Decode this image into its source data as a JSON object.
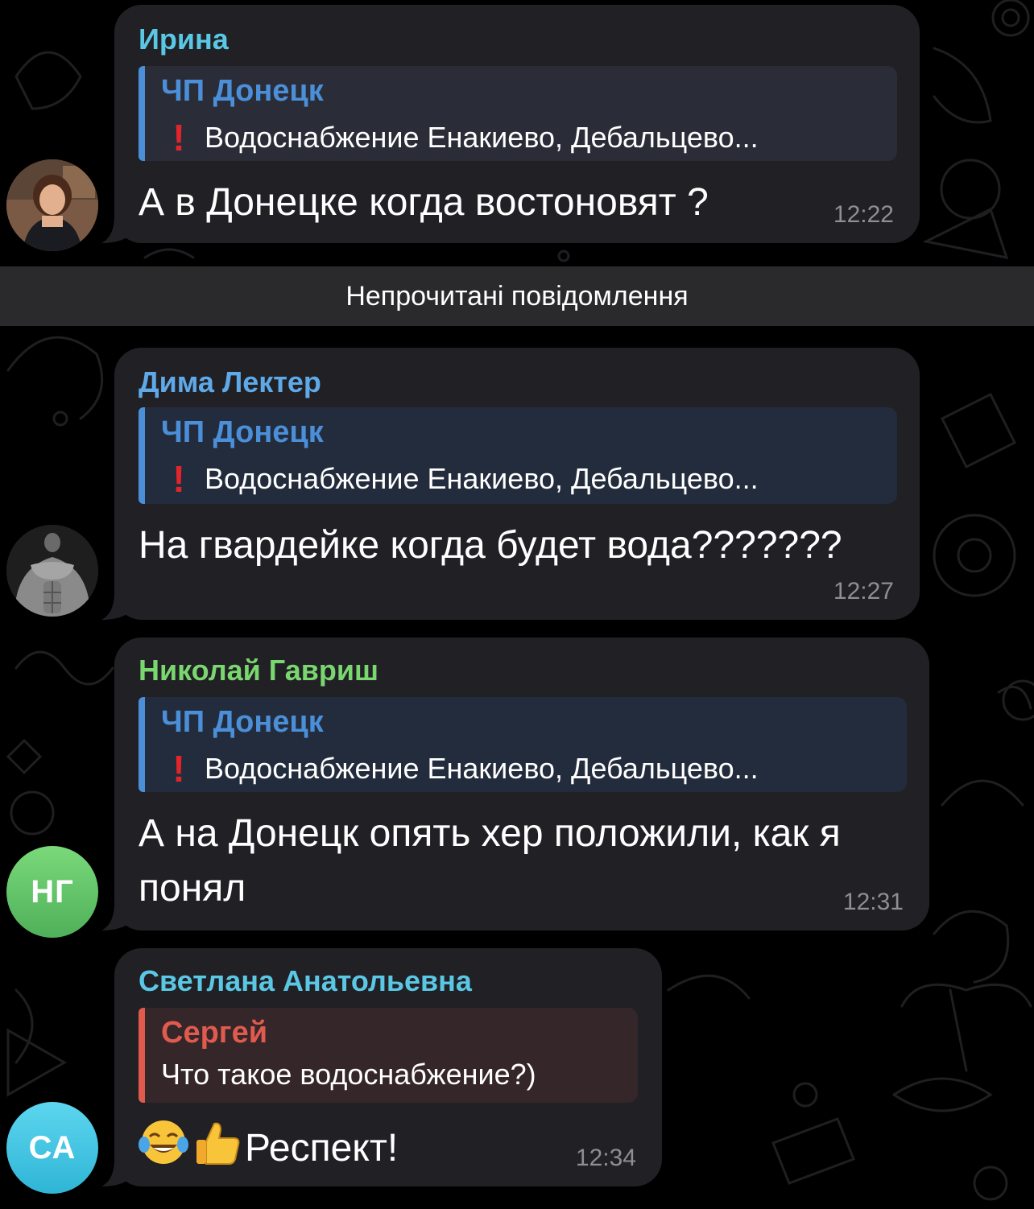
{
  "colors": {
    "bubble_bg": "#212025",
    "unread_bar_bg": "#2a2a2d",
    "sender_cyan": "#5ac8e5",
    "sender_blue": "#5fa9e8",
    "sender_green": "#7ad66f",
    "reply_blue": "#4b8fd9",
    "reply_red": "#e05a4e",
    "time_gray": "#8e8e93",
    "avatar_green": "#61c264",
    "avatar_cyan": "#3cc8e6"
  },
  "unread_divider": "Непрочитані повідомлення",
  "messages": [
    {
      "sender": "Ирина",
      "sender_color": "#5ac8e5",
      "avatar_icon": "photo-woman",
      "reply_title": "ЧП Донецк",
      "reply_text": "Водоснабжение Енакиево, Дебальцево...",
      "text": "А в Донецке когда востоновят ?",
      "time": "12:22"
    },
    {
      "sender": "Дима Лектер",
      "sender_color": "#5fa9e8",
      "avatar_icon": "photo-muscular-man",
      "reply_title": "ЧП Донецк",
      "reply_text": "Водоснабжение Енакиево, Дебальцево...",
      "text": "На гвардейке когда будет вода???????",
      "time": "12:27"
    },
    {
      "sender": "Николай Гавриш",
      "sender_color": "#7ad66f",
      "avatar_initials": "НГ",
      "reply_title": "ЧП Донецк",
      "reply_text": "Водоснабжение Енакиево, Дебальцево...",
      "text_line1": "А на Донецк опять хер положили, как я",
      "text_line2": "понял",
      "time": "12:31"
    },
    {
      "sender": "Светлана Анатольевна",
      "sender_color": "#5ac8e5",
      "avatar_initials": "СА",
      "reply_title": "Сергей",
      "reply_text": "Что такое водоснабжение?)",
      "emojis": [
        "tears-of-joy-emoji",
        "thumbs-up-emoji"
      ],
      "text": "Респект!",
      "time": "12:34"
    }
  ]
}
